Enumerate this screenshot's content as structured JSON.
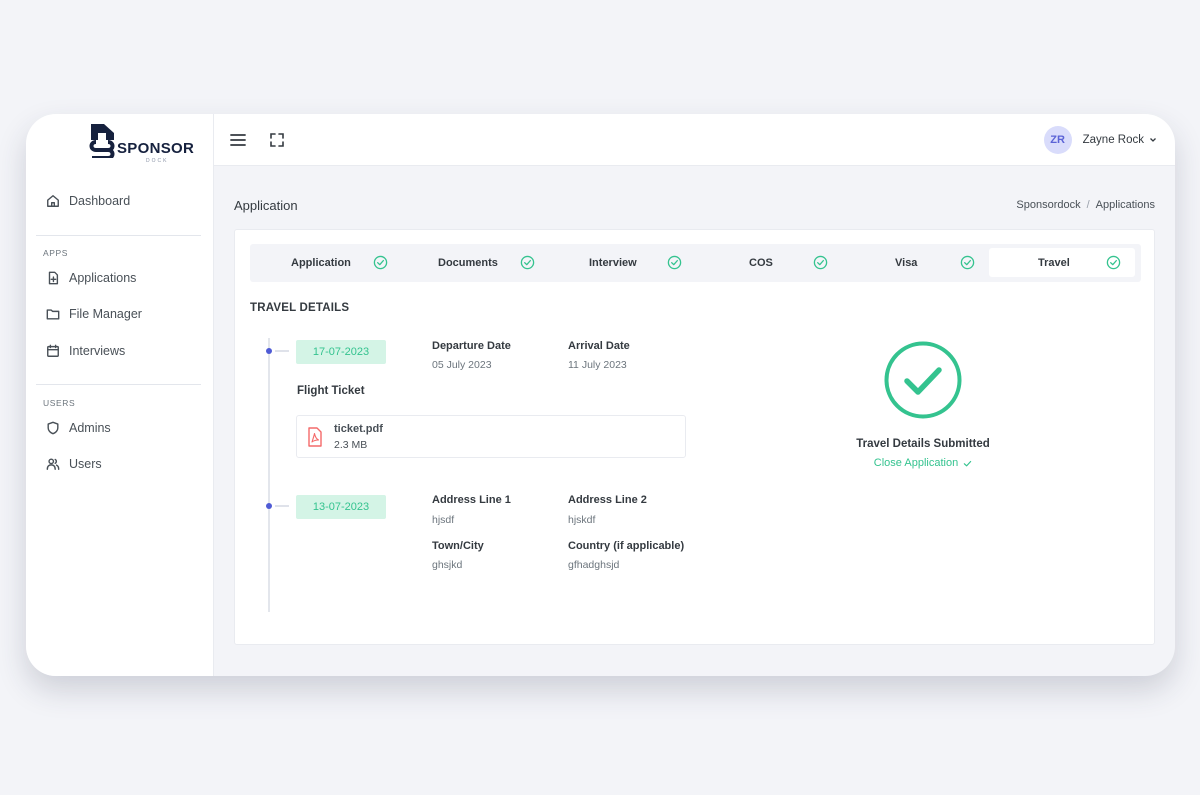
{
  "logo": {
    "word": "SPONSOR",
    "sub": "DOCK"
  },
  "sidebar": {
    "items": [
      {
        "label": "Dashboard",
        "icon": "home-icon"
      },
      {
        "label": "Applications",
        "icon": "file-plus-icon"
      },
      {
        "label": "File Manager",
        "icon": "folder-icon"
      },
      {
        "label": "Interviews",
        "icon": "calendar-icon"
      },
      {
        "label": "Admins",
        "icon": "shield-icon"
      },
      {
        "label": "Users",
        "icon": "users-icon"
      }
    ],
    "sections": [
      "APPS",
      "USERS"
    ]
  },
  "header": {
    "user_initials": "ZR",
    "user_name": "Zayne Rock"
  },
  "page": {
    "title": "Application",
    "breadcrumb": [
      "Sponsordock",
      "Applications"
    ]
  },
  "steps": [
    {
      "label": "Application",
      "done": true
    },
    {
      "label": "Documents",
      "done": true
    },
    {
      "label": "Interview",
      "done": true
    },
    {
      "label": "COS",
      "done": true
    },
    {
      "label": "Visa",
      "done": true
    },
    {
      "label": "Travel",
      "done": true,
      "active": true
    }
  ],
  "travel": {
    "section_title": "TRAVEL DETAILS",
    "entry1": {
      "date": "17-07-2023",
      "departure_label": "Departure Date",
      "departure_value": "05 July 2023",
      "arrival_label": "Arrival Date",
      "arrival_value": "11 July 2023",
      "flight_ticket_label": "Flight Ticket",
      "file_name": "ticket.pdf",
      "file_size": "2.3 MB"
    },
    "entry2": {
      "date": "13-07-2023",
      "address1_label": "Address Line 1",
      "address1_value": "hjsdf",
      "address2_label": "Address Line 2",
      "address2_value": "hjskdf",
      "town_label": "Town/City",
      "town_value": "ghsjkd",
      "country_label": "Country (if applicable)",
      "country_value": "gfhadghsjd"
    },
    "status": {
      "text": "Travel Details Submitted",
      "link": "Close Application"
    }
  },
  "colors": {
    "success": "#34c38f",
    "primary": "#4f5bd5",
    "danger": "#f46a6a"
  }
}
